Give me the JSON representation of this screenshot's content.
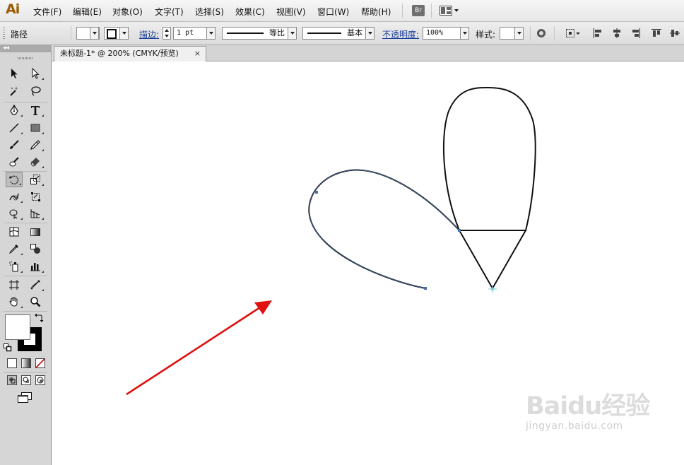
{
  "app": {
    "logo": "Ai"
  },
  "menu": {
    "items": [
      "文件(F)",
      "编辑(E)",
      "对象(O)",
      "文字(T)",
      "选择(S)",
      "效果(C)",
      "视图(V)",
      "窗口(W)",
      "帮助(H)"
    ],
    "bridge_label": "Br"
  },
  "control": {
    "object_type": "路径",
    "stroke_label": "描边:",
    "stroke_weight": "1 pt",
    "profile_label": "等比",
    "brush_label": "基本",
    "opacity_label": "不透明度:",
    "opacity_value": "100%",
    "style_label": "样式:"
  },
  "document": {
    "tab_title": "未标题-1* @ 200% (CMYK/预览)",
    "close_glyph": "×"
  },
  "tools": {
    "collapse_glyph": "◂◂",
    "selected_tool": "rotate-tool"
  },
  "colors": {
    "path_highlight": "#4a6fa5",
    "arrow": "#e01010",
    "logo": "#9a5b00"
  },
  "watermark": {
    "logo_text": "Baidu经验",
    "url": "jingyan.baidu.com"
  }
}
